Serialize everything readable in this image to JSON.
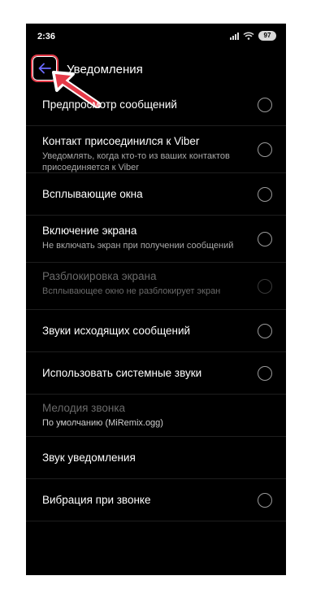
{
  "status_bar": {
    "time": "2:36",
    "battery": "97"
  },
  "app_bar": {
    "title": "Уведомления",
    "back_icon": "arrow-left-icon"
  },
  "colors": {
    "background": "#000000",
    "accent": "#6b6bff",
    "annotation": "#e53a48"
  },
  "settings": [
    {
      "title": "Предпросмотр сообщений",
      "subtitle": "",
      "toggle": "off",
      "enabled": true
    },
    {
      "title": "Контакт присоединился к Viber",
      "subtitle": "Уведомлять, когда кто-то из ваших контактов присоединяется к Viber",
      "toggle": "off",
      "enabled": true
    },
    {
      "title": "Всплывающие окна",
      "subtitle": "",
      "toggle": "off",
      "enabled": true
    },
    {
      "title": "Включение экрана",
      "subtitle": "Не включать экран при получении сообщений",
      "toggle": "off",
      "enabled": true
    },
    {
      "title": "Разблокировка экрана",
      "subtitle": "Всплывающее окно не разблокирует экран",
      "toggle": "off",
      "enabled": false
    },
    {
      "title": "Звуки исходящих сообщений",
      "subtitle": "",
      "toggle": "off",
      "enabled": true
    },
    {
      "title": "Использовать системные звуки",
      "subtitle": "",
      "toggle": "off",
      "enabled": true
    },
    {
      "title": "Мелодия звонка",
      "subtitle": "По умолчанию (MiRemix.ogg)",
      "toggle": "none",
      "enabled": false
    },
    {
      "title": "Звук уведомления",
      "subtitle": "",
      "toggle": "none",
      "enabled": true
    },
    {
      "title": "Вибрация при звонке",
      "subtitle": "",
      "toggle": "off",
      "enabled": true
    }
  ]
}
